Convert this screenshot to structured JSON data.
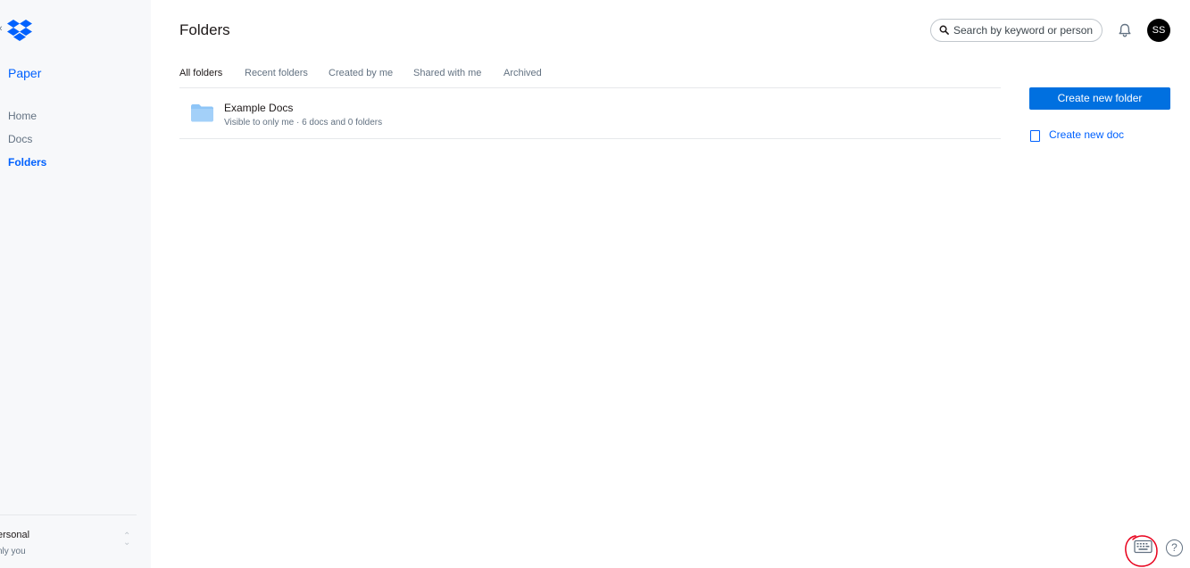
{
  "sidebar": {
    "logo": "dropbox-logo",
    "collapse_glyph": "‹",
    "brand": "Paper",
    "nav": [
      {
        "label": "Home",
        "active": false
      },
      {
        "label": "Docs",
        "active": false
      },
      {
        "label": "Folders",
        "active": true
      }
    ],
    "account": {
      "name": "ersonal",
      "subtitle": "nly you",
      "switch_icon": "chevron-up-down-icon"
    }
  },
  "header": {
    "title": "Folders",
    "search_placeholder": "Search by keyword or person",
    "avatar_initials": "SS"
  },
  "tabs": [
    {
      "label": "All folders",
      "active": true
    },
    {
      "label": "Recent folders",
      "active": false
    },
    {
      "label": "Created by me",
      "active": false
    },
    {
      "label": "Shared with me",
      "active": false
    },
    {
      "label": "Archived",
      "active": false
    }
  ],
  "folders": [
    {
      "name": "Example Docs",
      "meta": "Visible to only me · 6 docs and 0 folders"
    }
  ],
  "actions": {
    "create_folder": "Create new folder",
    "create_doc": "Create new doc"
  },
  "footer": {
    "help_glyph": "?"
  },
  "colors": {
    "accent": "#0061fe",
    "primary_button": "#0070e0",
    "sidebar_bg": "#f7f8fa",
    "folder_icon": "#8ec5f7",
    "annotation": "#e8001c"
  }
}
